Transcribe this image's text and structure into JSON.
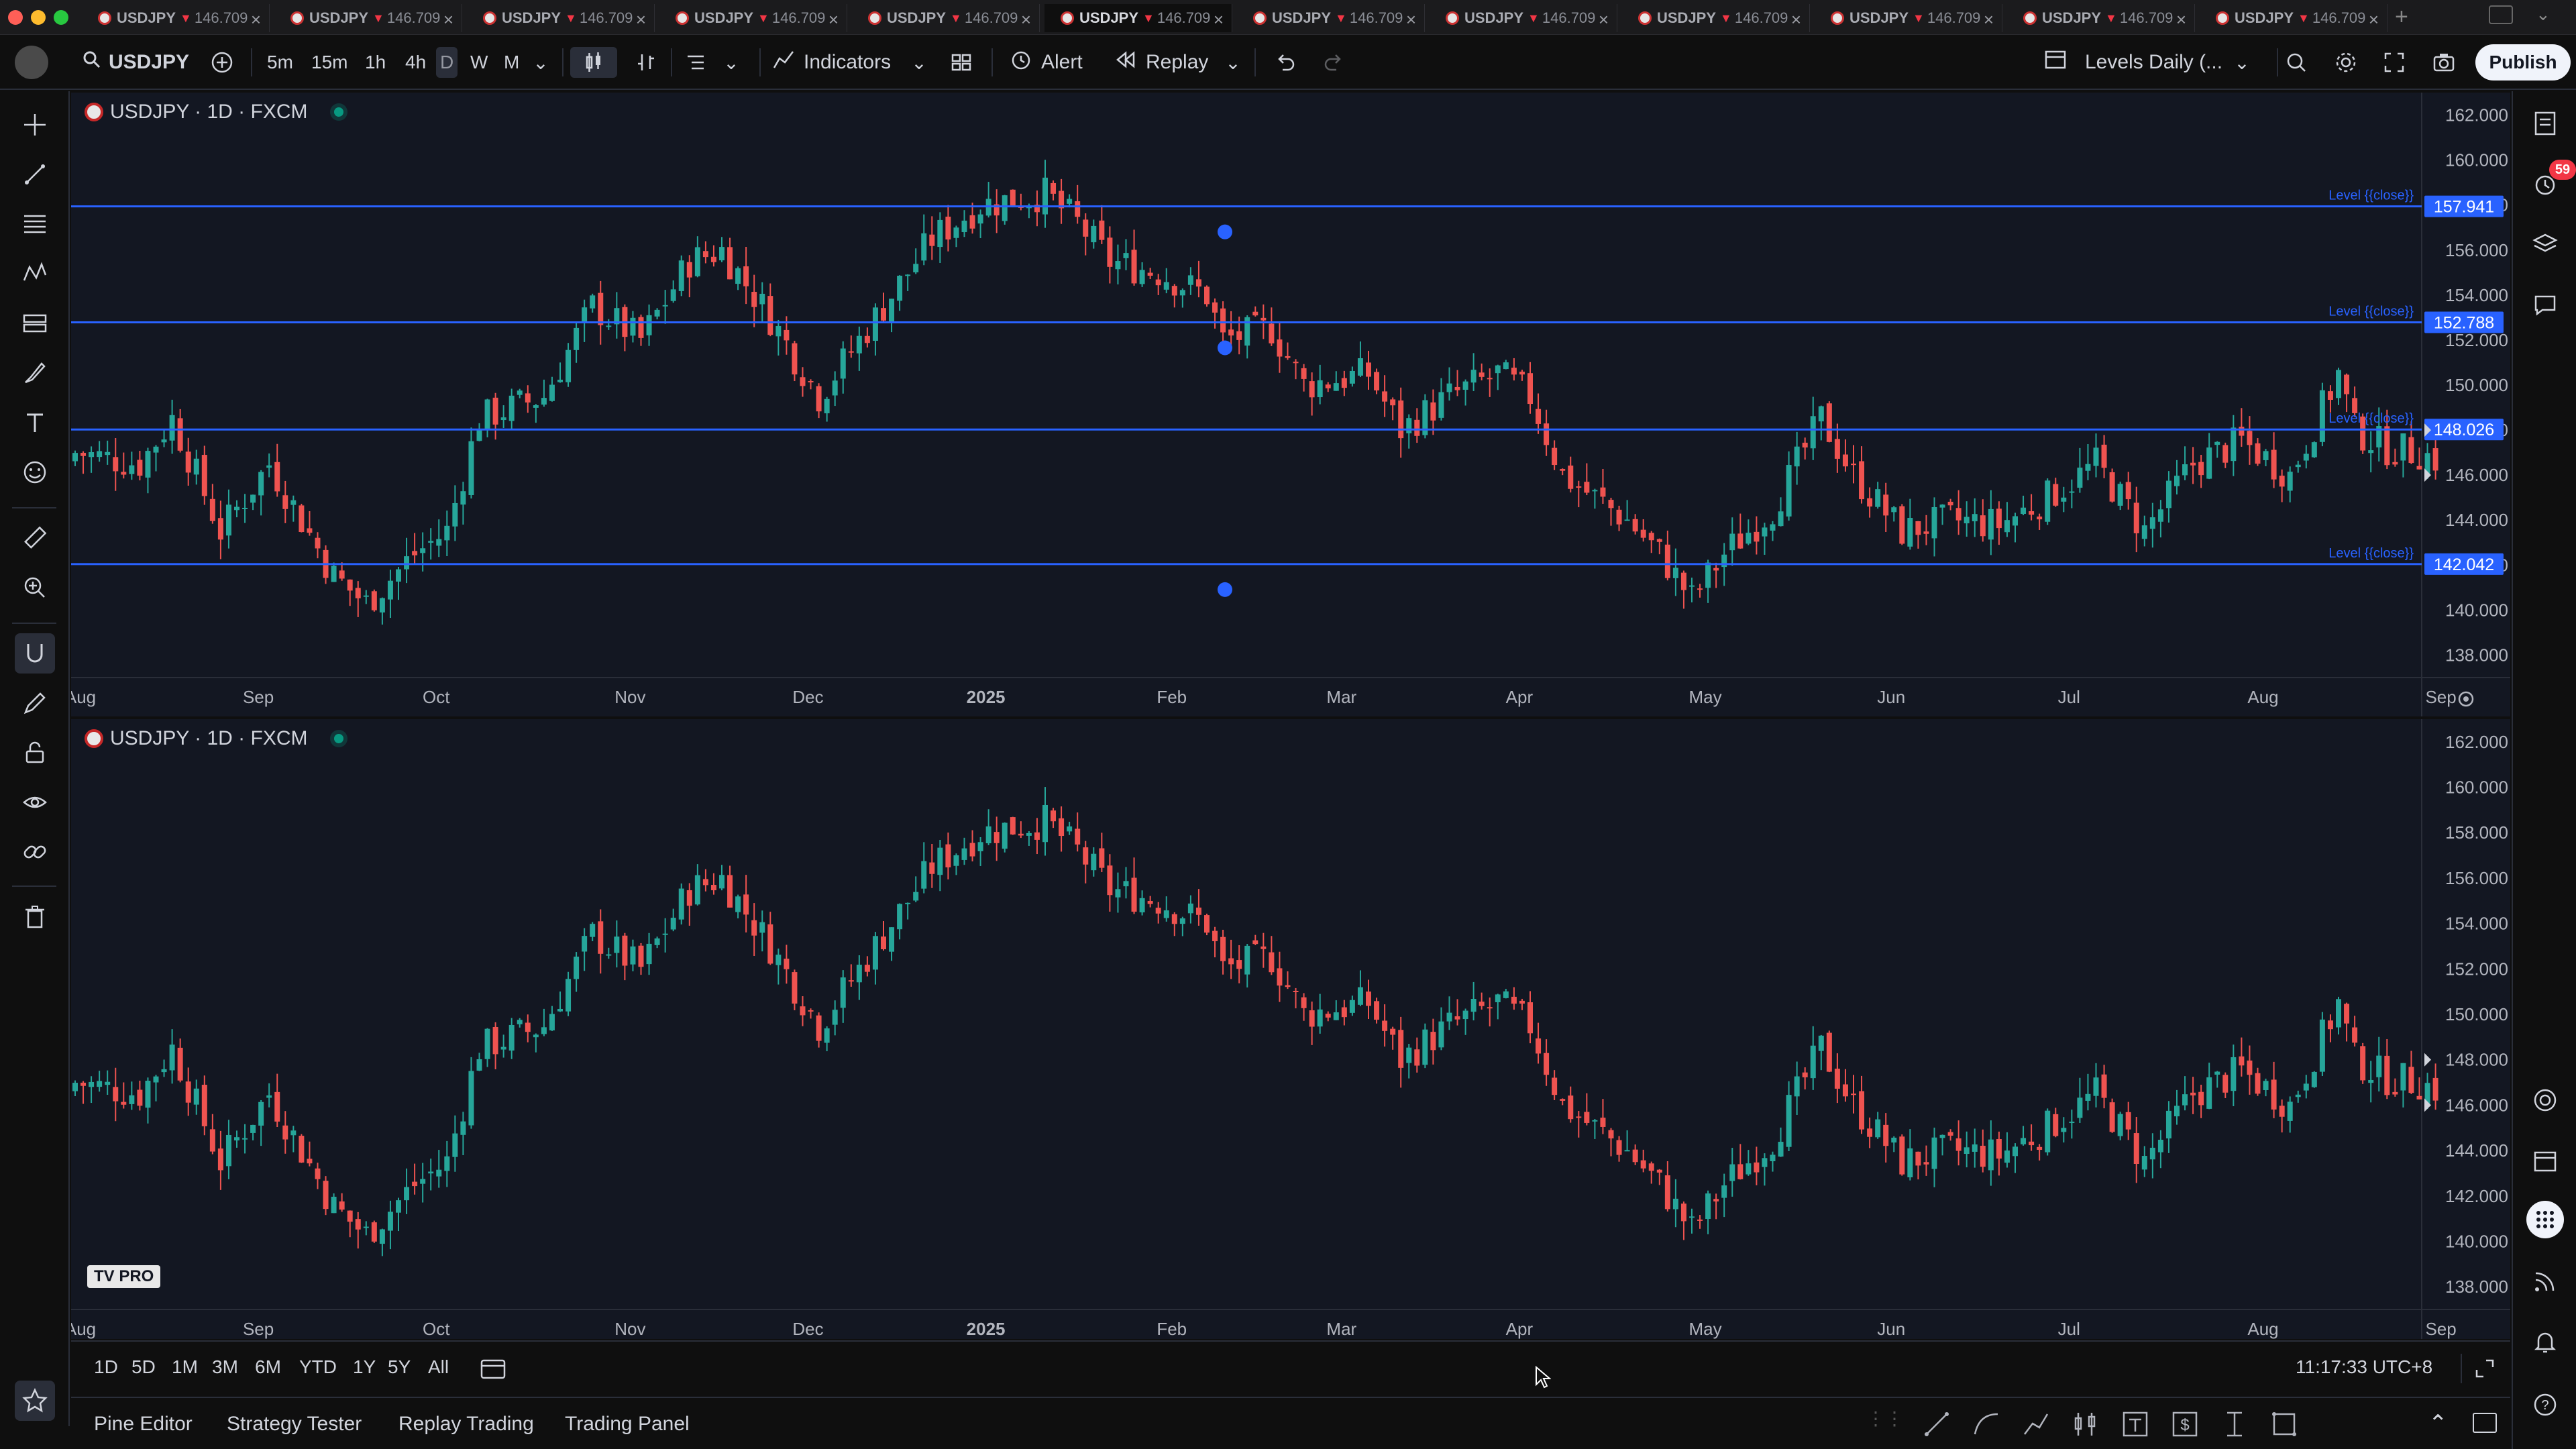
{
  "tabs": [
    {
      "symbol": "USDJPY",
      "price": "146.709"
    },
    {
      "symbol": "USDJPY",
      "price": "146.709"
    },
    {
      "symbol": "USDJPY",
      "price": "146.709"
    },
    {
      "symbol": "USDJPY",
      "price": "146.709"
    },
    {
      "symbol": "USDJPY",
      "price": "146.709"
    },
    {
      "symbol": "USDJPY",
      "price": "146.709"
    },
    {
      "symbol": "USDJPY",
      "price": "146.709"
    },
    {
      "symbol": "USDJPY",
      "price": "146.709"
    },
    {
      "symbol": "USDJPY",
      "price": "146.709"
    },
    {
      "symbol": "USDJPY",
      "price": "146.709"
    },
    {
      "symbol": "USDJPY",
      "price": "146.709"
    },
    {
      "symbol": "USDJPY",
      "price": "146.709"
    }
  ],
  "active_tab_index": 5,
  "toolbar": {
    "symbol": "USDJPY",
    "intervals": [
      "5m",
      "15m",
      "1h",
      "4h",
      "D",
      "W",
      "M"
    ],
    "active_interval": "D",
    "indicators_label": "Indicators",
    "alert_label": "Alert",
    "replay_label": "Replay",
    "layout_name": "Levels Daily (...",
    "publish_label": "Publish"
  },
  "notifications_count": "59",
  "panes": [
    {
      "legend": "USDJPY · 1D · FXCM",
      "levels": [
        {
          "label": "Level {{close}}",
          "value": "157.941",
          "price": 157.941
        },
        {
          "label": "Level {{close}}",
          "value": "152.788",
          "price": 152.788
        },
        {
          "label": "Level {{close}}",
          "value": "148.026",
          "price": 148.026
        },
        {
          "label": "Level {{close}}",
          "value": "142.042",
          "price": 142.042
        }
      ]
    },
    {
      "legend": "USDJPY · 1D · FXCM",
      "watermark": "TV PRO",
      "levels": []
    }
  ],
  "price_ticks": [
    "162.000",
    "160.000",
    "158.000",
    "156.000",
    "154.000",
    "152.000",
    "150.000",
    "148.000",
    "146.000",
    "144.000",
    "142.000",
    "140.000",
    "138.000"
  ],
  "time_ticks": [
    {
      "label": "Aug",
      "idx": 0
    },
    {
      "label": "Sep",
      "idx": 22
    },
    {
      "label": "Oct",
      "idx": 44
    },
    {
      "label": "Nov",
      "idx": 68
    },
    {
      "label": "Dec",
      "idx": 90
    },
    {
      "label": "2025",
      "idx": 112,
      "bold": true
    },
    {
      "label": "Feb",
      "idx": 135
    },
    {
      "label": "Mar",
      "idx": 156
    },
    {
      "label": "Apr",
      "idx": 178
    },
    {
      "label": "May",
      "idx": 201
    },
    {
      "label": "Jun",
      "idx": 224
    },
    {
      "label": "Jul",
      "idx": 246
    },
    {
      "label": "Aug",
      "idx": 270
    },
    {
      "label": "Sep",
      "idx": 292
    }
  ],
  "range_buttons": [
    "1D",
    "5D",
    "1M",
    "3M",
    "6M",
    "YTD",
    "1Y",
    "5Y",
    "All"
  ],
  "clock": "11:17:33 UTC+8",
  "bottom_tabs": [
    "Pine Editor",
    "Strategy Tester",
    "Replay Trading",
    "Trading Panel"
  ],
  "colors": {
    "up": "#26a69a",
    "down": "#ef5350",
    "level": "#2962ff",
    "bg": "#131722",
    "grid": "#1e222d"
  },
  "chart_data": {
    "type": "candlestick",
    "symbol": "USDJPY",
    "interval": "1D",
    "source": "FXCM",
    "ylim": [
      137,
      163
    ],
    "close_points": [
      [
        0,
        147.0
      ],
      [
        8,
        146.5
      ],
      [
        12,
        148.5
      ],
      [
        18,
        143.5
      ],
      [
        24,
        146.5
      ],
      [
        32,
        141.5
      ],
      [
        36,
        140.3
      ],
      [
        42,
        142.5
      ],
      [
        46,
        143.5
      ],
      [
        50,
        148.5
      ],
      [
        58,
        149.5
      ],
      [
        64,
        153.5
      ],
      [
        70,
        152.0
      ],
      [
        76,
        155.5
      ],
      [
        80,
        156.0
      ],
      [
        86,
        153.0
      ],
      [
        92,
        149.5
      ],
      [
        100,
        153.5
      ],
      [
        106,
        156.5
      ],
      [
        112,
        158.0
      ],
      [
        120,
        158.5
      ],
      [
        124,
        157.2
      ],
      [
        128,
        155.5
      ],
      [
        134,
        155.0
      ],
      [
        140,
        154.0
      ],
      [
        142,
        152.0
      ],
      [
        148,
        152.5
      ],
      [
        152,
        150.0
      ],
      [
        160,
        150.5
      ],
      [
        164,
        148.0
      ],
      [
        170,
        149.5
      ],
      [
        176,
        150.5
      ],
      [
        180,
        149.5
      ],
      [
        184,
        146.0
      ],
      [
        192,
        144.0
      ],
      [
        196,
        142.5
      ],
      [
        200,
        140.5
      ],
      [
        204,
        142.5
      ],
      [
        210,
        144.5
      ],
      [
        216,
        148.5
      ],
      [
        220,
        146.0
      ],
      [
        226,
        143.5
      ],
      [
        232,
        144.0
      ],
      [
        238,
        143.8
      ],
      [
        244,
        145.0
      ],
      [
        250,
        146.5
      ],
      [
        256,
        143.5
      ],
      [
        262,
        146.5
      ],
      [
        268,
        147.5
      ],
      [
        274,
        146.0
      ],
      [
        280,
        150.5
      ],
      [
        282,
        148.0
      ],
      [
        286,
        147.2
      ],
      [
        290,
        147.0
      ],
      [
        292,
        146.7
      ]
    ]
  }
}
